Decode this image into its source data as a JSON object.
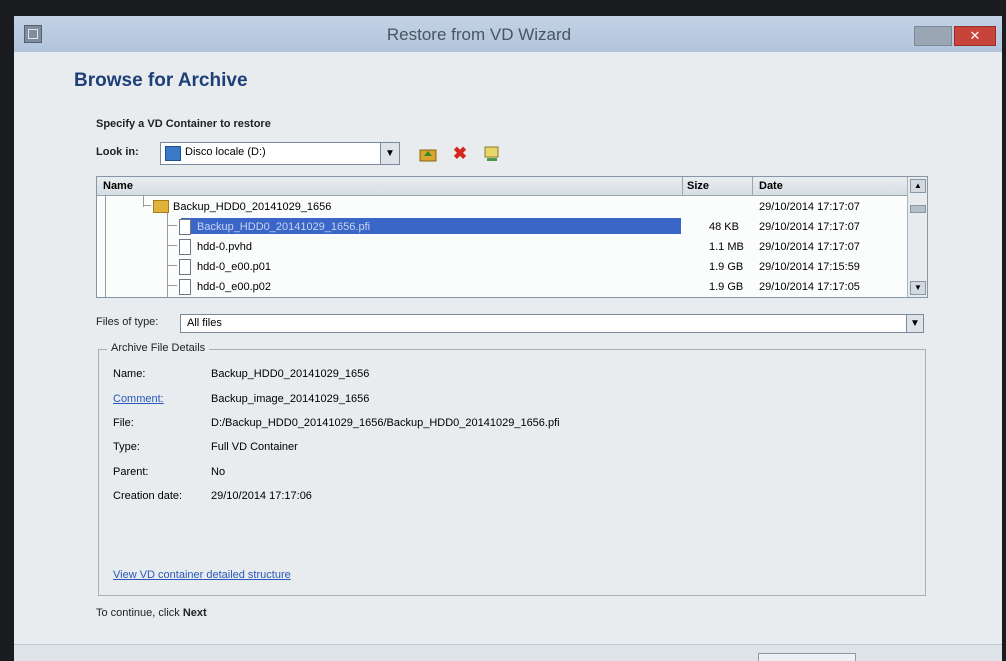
{
  "window": {
    "title": "Restore from VD Wizard",
    "close_label": "✕"
  },
  "page": {
    "header": "Browse for Archive",
    "instruction": "Specify a VD Container to restore"
  },
  "lookin": {
    "label": "Look in:",
    "value": "Disco locale (D:)"
  },
  "toolbar": {
    "icons": [
      "up-folder-icon",
      "delete-icon",
      "properties-icon"
    ],
    "delete_glyph": "✖"
  },
  "file_list": {
    "columns": [
      "Name",
      "Size",
      "Date"
    ],
    "rows": [
      {
        "name": "Backup_HDD0_20141029_1656",
        "size": "",
        "date": "29/10/2014 17:17:07",
        "type": "folder"
      },
      {
        "name": "Backup_HDD0_20141029_1656.pfi",
        "size": "48 KB",
        "date": "29/10/2014 17:17:07",
        "type": "file",
        "selected": true
      },
      {
        "name": "hdd-0.pvhd",
        "size": "1.1 MB",
        "date": "29/10/2014 17:17:07",
        "type": "file"
      },
      {
        "name": "hdd-0_e00.p01",
        "size": "1.9 GB",
        "date": "29/10/2014 17:15:59",
        "type": "file"
      },
      {
        "name": "hdd-0_e00.p02",
        "size": "1.9 GB",
        "date": "29/10/2014 17:17:05",
        "type": "file"
      }
    ]
  },
  "filetype": {
    "label": "Files of type:",
    "value": "All files"
  },
  "details": {
    "legend": "Archive File Details",
    "rows": [
      {
        "key": "Name:",
        "value": "Backup_HDD0_20141029_1656"
      },
      {
        "key": "Comment:",
        "value": "Backup_image_20141029_1656"
      },
      {
        "key": "File:",
        "value": "D:/Backup_HDD0_20141029_1656/Backup_HDD0_20141029_1656.pfi"
      },
      {
        "key": "Type:",
        "value": "Full VD Container"
      },
      {
        "key": "Parent:",
        "value": "No"
      },
      {
        "key": "Creation date:",
        "value": "29/10/2014 17:17:06"
      }
    ],
    "link": "View VD container detailed structure"
  },
  "footer": {
    "prefix": "To continue, click",
    "next_word": "Next"
  }
}
